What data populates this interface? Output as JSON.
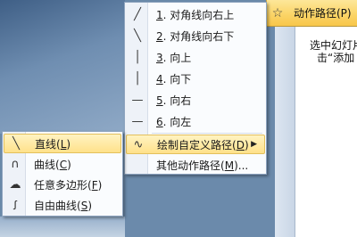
{
  "ribbon": {
    "label": "动作路径(P)",
    "icon": "star-icon"
  },
  "pane": {
    "hint_line1": "选中幻灯片",
    "hint_line2": "击“添加"
  },
  "main_menu": {
    "items": [
      {
        "num": "1",
        "text": "对角线向右上",
        "icon": "diagonal-up-icon"
      },
      {
        "num": "2",
        "text": "对角线向右下",
        "icon": "diagonal-down-icon"
      },
      {
        "num": "3",
        "text": "向上",
        "icon": "line-up-icon"
      },
      {
        "num": "4",
        "text": "向下",
        "icon": "line-down-icon"
      },
      {
        "num": "5",
        "text": "向右",
        "icon": "line-right-icon"
      },
      {
        "num": "6",
        "text": "向左",
        "icon": "line-left-icon"
      }
    ],
    "custom_path": {
      "text": "绘制自定义路径",
      "key": "D",
      "icon": "curve-icon"
    },
    "other_paths": {
      "text": "其他动作路径",
      "key": "M",
      "suffix": "..."
    }
  },
  "sub_menu": {
    "items": [
      {
        "text": "直线",
        "key": "L",
        "icon": "straight-line-icon"
      },
      {
        "text": "曲线",
        "key": "C",
        "icon": "curve-icon"
      },
      {
        "text": "任意多边形",
        "key": "F",
        "icon": "freeform-polygon-icon"
      },
      {
        "text": "自由曲线",
        "key": "S",
        "icon": "scribble-icon"
      }
    ]
  }
}
